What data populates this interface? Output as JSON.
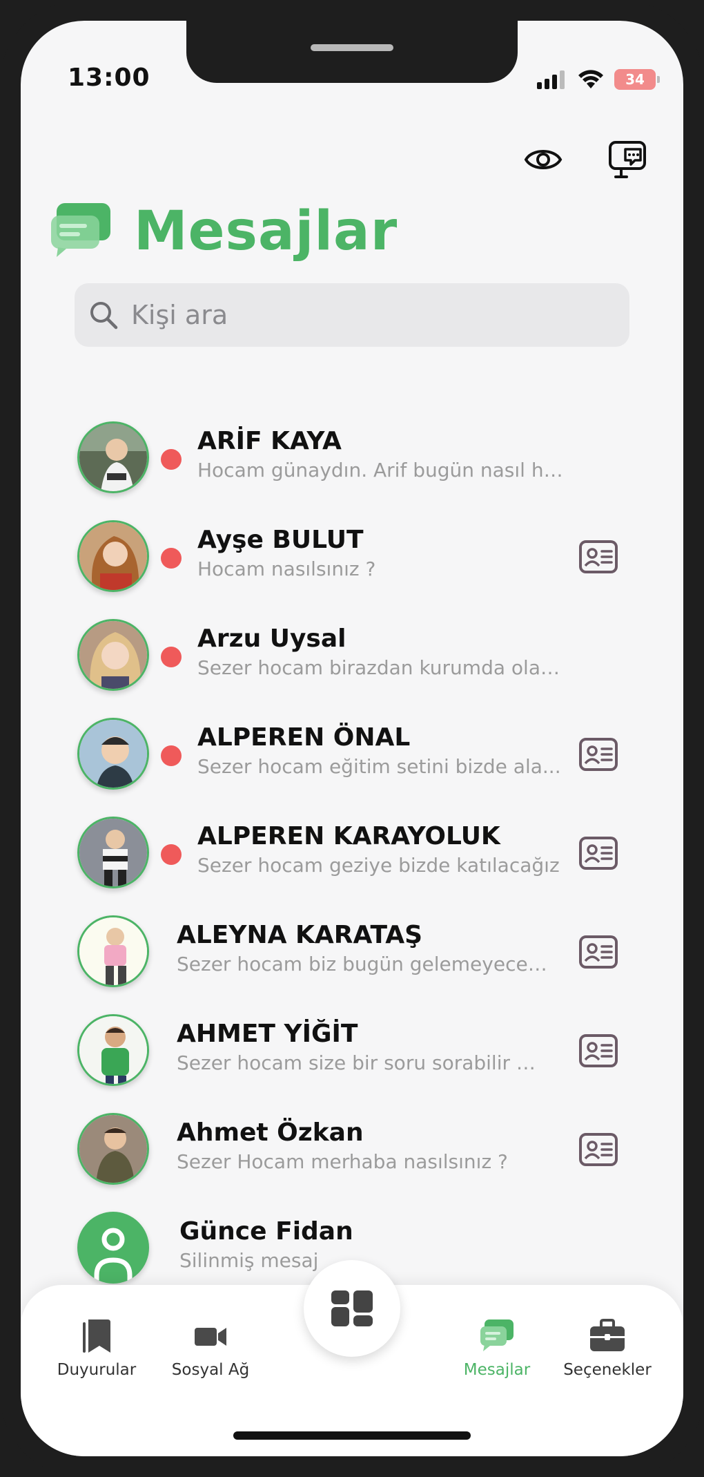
{
  "status_bar": {
    "time": "13:00",
    "battery": "34"
  },
  "header": {
    "title": "Mesajlar"
  },
  "search": {
    "placeholder": "Kişi ara"
  },
  "conversations": [
    {
      "name": "ARİF KAYA",
      "preview": "Hocam günaydın. Arif bugün nasıl hocam ?",
      "unread": true,
      "has_card": false
    },
    {
      "name": "Ayşe BULUT",
      "preview": "Hocam nasılsınız ?",
      "unread": true,
      "has_card": true
    },
    {
      "name": "Arzu Uysal",
      "preview": "Sezer hocam birazdan kurumda olacağız.",
      "unread": true,
      "has_card": false
    },
    {
      "name": "ALPEREN ÖNAL",
      "preview": "Sezer hocam eğitim setini bizde ala...",
      "unread": true,
      "has_card": true
    },
    {
      "name": "ALPEREN KARAYOLUK",
      "preview": "Sezer hocam geziye bizde katılacağız",
      "unread": true,
      "has_card": true
    },
    {
      "name": "ALEYNA KARATAŞ",
      "preview": "Sezer hocam biz bugün gelemeyeceğiz...",
      "unread": false,
      "has_card": true
    },
    {
      "name": "AHMET YİĞİT",
      "preview": "Sezer hocam size bir soru sorabilir miy...",
      "unread": false,
      "has_card": true
    },
    {
      "name": "Ahmet Özkan",
      "preview": "Sezer Hocam merhaba nasılsınız ?",
      "unread": false,
      "has_card": true
    },
    {
      "name": "Günce Fidan",
      "preview": "Silinmiş mesaj",
      "unread": false,
      "has_card": false
    }
  ],
  "tabbar": {
    "items": [
      {
        "label": "Duyurular",
        "icon": "bookmark-icon",
        "active": false
      },
      {
        "label": "Sosyal Ağ",
        "icon": "video-camera-icon",
        "active": false
      },
      {
        "label": "Mesajlar",
        "icon": "chat-bubbles-icon",
        "active": true
      },
      {
        "label": "Seçenekler",
        "icon": "briefcase-icon",
        "active": false
      }
    ],
    "center_icon": "dashboard-icon"
  },
  "colors": {
    "accent": "#4cb466",
    "unread": "#ef5a5a",
    "card_icon": "#6b5a66"
  }
}
